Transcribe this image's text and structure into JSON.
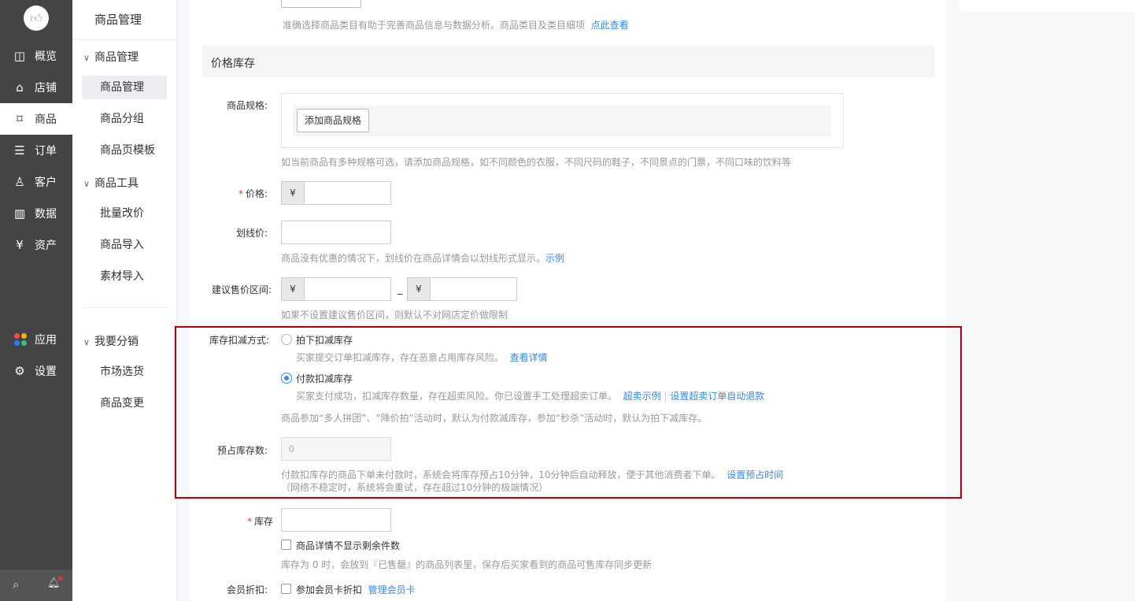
{
  "nav": {
    "items": [
      {
        "label": "概览",
        "icon": "dashboard-icon",
        "glyph": "◫"
      },
      {
        "label": "店铺",
        "icon": "store-icon",
        "glyph": "⌂"
      },
      {
        "label": "商品",
        "icon": "tag-icon",
        "glyph": "⌑"
      },
      {
        "label": "订单",
        "icon": "order-icon",
        "glyph": "☰"
      },
      {
        "label": "客户",
        "icon": "user-icon",
        "glyph": "♙"
      },
      {
        "label": "数据",
        "icon": "bar-chart-icon",
        "glyph": "▥"
      },
      {
        "label": "资产",
        "icon": "yen-coin-icon",
        "glyph": "¥"
      }
    ],
    "apps_label": "应用",
    "settings_label": "设置",
    "settings_glyph": "⚙",
    "search_glyph": "⌕",
    "bell_glyph": "🔔︎",
    "logo_glyph": "👍︎"
  },
  "sub": {
    "title": "商品管理",
    "chevron": "∨",
    "groups": [
      {
        "label": "商品管理",
        "items": [
          "商品管理",
          "商品分组",
          "商品页模板"
        ]
      },
      {
        "label": "商品工具",
        "items": [
          "批量改价",
          "商品导入",
          "素材导入"
        ]
      },
      {
        "label": "我要分销",
        "items": [
          "市场选货",
          "商品变更"
        ]
      }
    ]
  },
  "category": {
    "help": "准确选择商品类目有助于完善商品信息与数据分析。商品类目及类目细项",
    "link": "点此查看"
  },
  "section_title": "价格库存",
  "spec": {
    "label": "商品规格:",
    "button": "添加商品规格",
    "help": "如当前商品有多种规格可选，请添加商品规格，如不同颜色的衣服，不同尺码的鞋子，不同景点的门票，不同口味的饮料等"
  },
  "price": {
    "star": "*",
    "label": "价格:",
    "currency": "¥"
  },
  "strike_price": {
    "label": "划线价:",
    "help": "商品没有优惠的情况下，划线价在商品详情会以划线形式显示。",
    "link": "示例"
  },
  "suggest_range": {
    "label": "建议售价区间:",
    "currency": "¥",
    "dash": "_",
    "help": "如果不设置建议售价区间，则默认不对网店定价做限制"
  },
  "stock_deduct": {
    "label": "库存扣减方式:",
    "option1": "拍下扣减库存",
    "option1_help": "买家提交订单扣减库存，存在恶意占用库存风险。",
    "option1_link": "查看详情",
    "option2": "付款扣减库存",
    "option2_help": "买家支付成功，扣减库存数量，存在超卖风险。你已设置手工处理超卖订单。",
    "option2_link1": "超卖示例",
    "option2_link2": "设置超卖订单自动退款",
    "selected": "付款扣减库存",
    "note": "商品参加“多人拼团”、“降价拍”活动时，默认为付款减库存，参加“秒杀”活动时，默认为拍下减库存。"
  },
  "reserve": {
    "label": "预占库存数:",
    "value": "0",
    "help1": "付款扣库存的商品下单未付款时，系统会将库存预占10分钟，10分钟后自动释放，便于其他消费者下单。",
    "link": "设置预占时间",
    "help2": "（网络不稳定时，系统将会重试，存在超过10分钟的极端情况）"
  },
  "stock": {
    "star": "*",
    "label": "库存",
    "hide_remaining": "商品详情不显示剩余件数",
    "help": "库存为 0 时，会放到『已售罄』的商品列表里，保存后买家看到的商品可售库存同步更新"
  },
  "member": {
    "label": "会员折扣:",
    "checkbox": "参加会员卡折扣",
    "link": "管理会员卡"
  },
  "colors": {
    "accent": "#3388ff",
    "highlight_border": "#c00000",
    "nav_bg": "#444444"
  }
}
